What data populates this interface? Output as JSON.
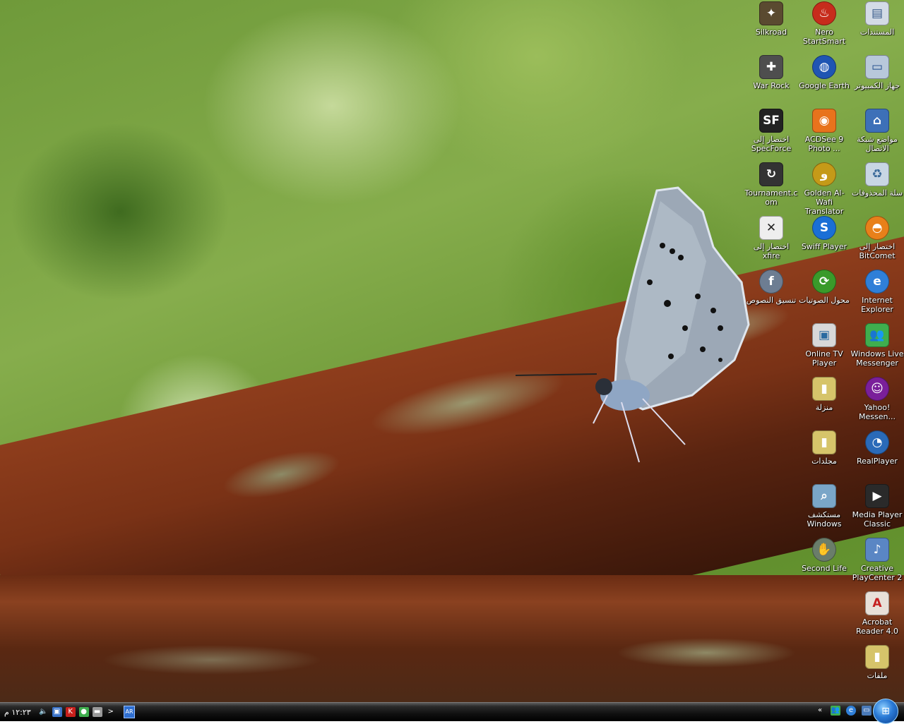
{
  "taskbar": {
    "clock": "١٢:٢٣ م",
    "language": "AR",
    "chevron": "«",
    "expand": ">"
  },
  "icons": {
    "silkroad": "Silkroad",
    "nero": "Nero StartSmart",
    "documents": "المستندات",
    "warrock": "War Rock",
    "google_earth": "Google Earth",
    "my_computer": "جهاز الكمبيوتر",
    "specforce": "اختصار إلى SpecForce",
    "acdsee": "ACDSee 9 Photo ...",
    "network": "مواضع شبكة الاتصال",
    "tournament": "Tournament.com",
    "golden_wafi": "Golden Al-Wafi Translator",
    "recycle_bin": "سلة المحذوفات",
    "xfire": "اختصار إلى xfire",
    "swiff": "Swiff Player",
    "bitcomet": "اختصار إلى BitComet",
    "tansiq": "تنسيق النصوص",
    "audio_converter": "محول الصوتيات",
    "ie": "Internet Explorer",
    "online_tv": "Online TV Player",
    "wlm": "Windows Live Messenger",
    "manzila": "منزلة",
    "yahoo": "Yahoo! Messen...",
    "folders": "مجلدات",
    "realplayer": "RealPlayer",
    "explorer": "مستكشف Windows",
    "mpc": "Media Player Classic",
    "second_life": "Second Life",
    "creative": "Creative PlayCenter 2",
    "acrobat": "Acrobat Reader 4.0",
    "files": "ملفات"
  }
}
